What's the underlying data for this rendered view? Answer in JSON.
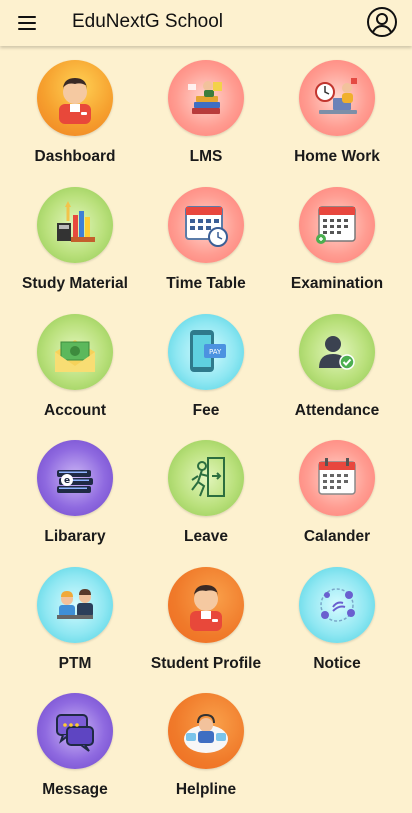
{
  "header": {
    "title": "EduNextG School",
    "menu_icon": "menu-icon",
    "profile_icon": "account-circle-icon"
  },
  "menu": [
    {
      "label": "Dashboard",
      "icon": "dashboard-user-icon"
    },
    {
      "label": "LMS",
      "icon": "lms-books-icon"
    },
    {
      "label": "Home Work",
      "icon": "homework-icon"
    },
    {
      "label": "Study Material",
      "icon": "study-material-icon"
    },
    {
      "label": "Time Table",
      "icon": "calendar-clock-icon"
    },
    {
      "label": "Examination",
      "icon": "examination-calendar-icon"
    },
    {
      "label": "Account",
      "icon": "money-envelope-icon"
    },
    {
      "label": "Fee",
      "icon": "phone-pay-icon"
    },
    {
      "label": "Attendance",
      "icon": "user-check-icon"
    },
    {
      "label": "Libarary",
      "icon": "ebooks-stack-icon"
    },
    {
      "label": "Leave",
      "icon": "exit-door-icon"
    },
    {
      "label": "Calander",
      "icon": "calendar-icon"
    },
    {
      "label": "PTM",
      "icon": "parent-teacher-meeting-icon"
    },
    {
      "label": "Student Profile",
      "icon": "student-profile-icon"
    },
    {
      "label": "Notice",
      "icon": "notice-network-icon"
    },
    {
      "label": "Message",
      "icon": "chat-bubbles-icon"
    },
    {
      "label": "Helpline",
      "icon": "helpline-support-icon"
    }
  ]
}
